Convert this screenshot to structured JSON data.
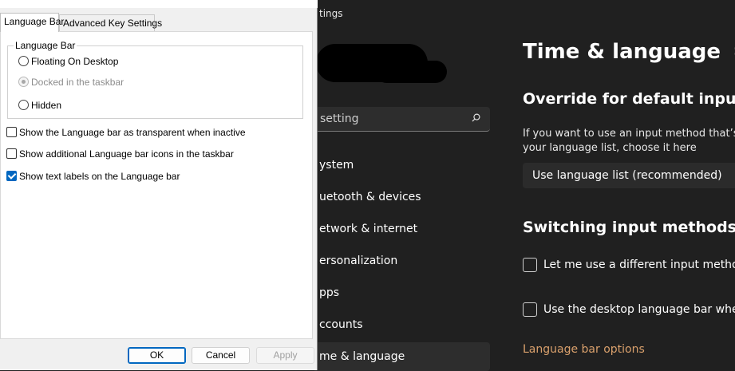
{
  "settings": {
    "title_fragment": "tings",
    "search": {
      "value": "setting"
    },
    "nav_items": [
      {
        "label": "ystem"
      },
      {
        "label": "uetooth & devices"
      },
      {
        "label": "etwork & internet"
      },
      {
        "label": "ersonalization"
      },
      {
        "label": "pps"
      },
      {
        "label": "ccounts"
      },
      {
        "label": "me & language",
        "selected": true
      }
    ],
    "content": {
      "breadcrumb_parent": "Time & language",
      "breadcrumb_separator": "›",
      "breadcrumb_current": "T",
      "override_title": "Override for default input me",
      "override_desc_line1": "If you want to use an input method that’s d",
      "override_desc_line2": "your language list, choose it here",
      "override_select_value": "Use language list (recommended)",
      "switching_title": "Switching input methods",
      "check_different_method": "Let me use a different input method fo",
      "check_desktop_bar": "Use the desktop language bar when it’",
      "language_bar_link": "Language bar options"
    }
  },
  "dialog": {
    "tabs": [
      {
        "label": "Language Bar",
        "active": true
      },
      {
        "label": "Advanced Key Settings",
        "active": false
      }
    ],
    "group_label": "Language Bar",
    "radios": [
      {
        "label": "Floating On Desktop",
        "checked": false,
        "disabled": false
      },
      {
        "label": "Docked in the taskbar",
        "checked": true,
        "disabled": true
      },
      {
        "label": "Hidden",
        "checked": false,
        "disabled": false
      }
    ],
    "checkboxes": [
      {
        "label": "Show the Language bar as transparent when inactive",
        "checked": false
      },
      {
        "label": "Show additional Language bar icons in the taskbar",
        "checked": false
      },
      {
        "label": "Show text labels on the Language bar",
        "checked": true
      }
    ],
    "buttons": {
      "ok": "OK",
      "cancel": "Cancel",
      "apply": "Apply"
    }
  },
  "colors": {
    "settings_bg": "#202020",
    "accent_link": "#d9a06c",
    "checkbox_accent": "#0067c0"
  }
}
